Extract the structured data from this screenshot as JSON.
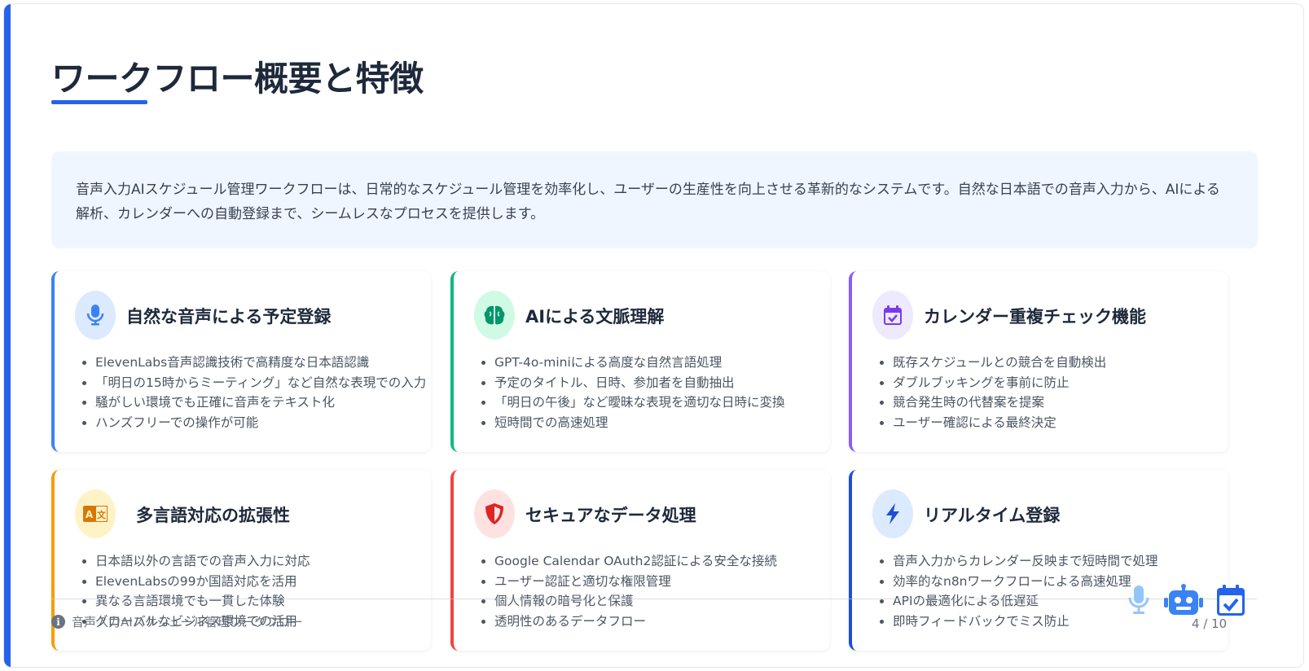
{
  "title": "ワークフロー概要と特徴",
  "intro": "音声入力AIスケジュール管理ワークフローは、日常的なスケジュール管理を効率化し、ユーザーの生産性を向上させる革新的なシステムです。自然な日本語での音声入力から、AIによる解析、カレンダーへの自動登録まで、シームレスなプロセスを提供します。",
  "cards": [
    {
      "title": "自然な音声による予定登録",
      "icon": "microphone-icon",
      "accent": "#3b82f6",
      "icon_bg": "#dbeafe",
      "items": [
        "ElevenLabs音声認識技術で高精度な日本語認識",
        "「明日の15時からミーティング」など自然な表現での入力",
        "騒がしい環境でも正確に音声をテキスト化",
        "ハンズフリーでの操作が可能"
      ]
    },
    {
      "title": "AIによる文脈理解",
      "icon": "brain-icon",
      "accent": "#10b981",
      "icon_bg": "#d1fae5",
      "items": [
        "GPT-4o-miniによる高度な自然言語処理",
        "予定のタイトル、日時、参加者を自動抽出",
        "「明日の午後」など曖昧な表現を適切な日時に変換",
        "短時間での高速処理"
      ]
    },
    {
      "title": "カレンダー重複チェック機能",
      "icon": "calendar-check-icon",
      "accent": "#8b5cf6",
      "icon_bg": "#ede9fe",
      "items": [
        "既存スケジュールとの競合を自動検出",
        "ダブルブッキングを事前に防止",
        "競合発生時の代替案を提案",
        "ユーザー確認による最終決定"
      ]
    },
    {
      "title": "多言語対応の拡張性",
      "icon": "language-icon",
      "accent": "#f59e0b",
      "icon_bg": "#fef3c7",
      "items": [
        "日本語以外の言語での音声入力に対応",
        "ElevenLabsの99か国語対応を活用",
        "異なる言語環境でも一貫した体験",
        "グローバルなビジネス環境での活用"
      ]
    },
    {
      "title": "セキュアなデータ処理",
      "icon": "shield-icon",
      "accent": "#ef4444",
      "icon_bg": "#fee2e2",
      "items": [
        "Google Calendar OAuth2認証による安全な接続",
        "ユーザー認証と適切な権限管理",
        "個人情報の暗号化と保護",
        "透明性のあるデータフロー"
      ]
    },
    {
      "title": "リアルタイム登録",
      "icon": "bolt-icon",
      "accent": "#1d4ed8",
      "icon_bg": "#dbeafe",
      "items": [
        "音声入力からカレンダー反映まで短時間で処理",
        "効率的なn8nワークフローによる高速処理",
        "APIの最適化による低遅延",
        "即時フィードバックでミス防止"
      ]
    }
  ],
  "footer": {
    "label": "音声入力AIスケジュール管理ワークフロー",
    "page": "4 / 10",
    "icons": [
      "microphone-icon",
      "robot-icon",
      "calendar-check-icon"
    ]
  }
}
